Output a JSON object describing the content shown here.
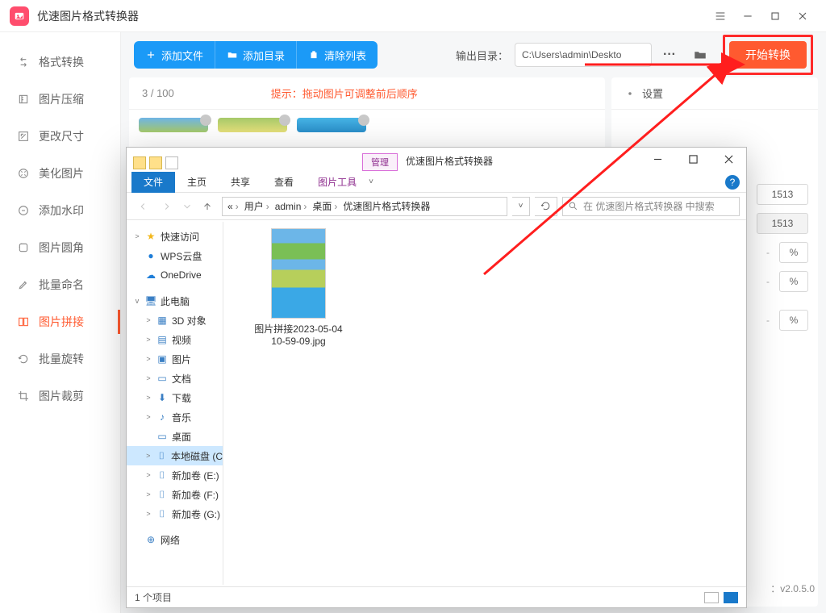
{
  "app": {
    "title": "优速图片格式转换器",
    "window_buttons": {
      "menu": "≡",
      "min": "—",
      "max": "⛶",
      "close": "✕"
    }
  },
  "sidebar": {
    "items": [
      {
        "label": "格式转换",
        "icon": "convert"
      },
      {
        "label": "图片压缩",
        "icon": "compress"
      },
      {
        "label": "更改尺寸",
        "icon": "resize"
      },
      {
        "label": "美化图片",
        "icon": "beautify"
      },
      {
        "label": "添加水印",
        "icon": "watermark"
      },
      {
        "label": "图片圆角",
        "icon": "corner"
      },
      {
        "label": "批量命名",
        "icon": "rename"
      },
      {
        "label": "图片拼接",
        "icon": "stitch",
        "active": true
      },
      {
        "label": "批量旋转",
        "icon": "rotate"
      },
      {
        "label": "图片裁剪",
        "icon": "crop"
      }
    ]
  },
  "toolbar": {
    "add_file": "添加文件",
    "add_dir": "添加目录",
    "clear": "清除列表",
    "out_label": "输出目录：",
    "out_path": "C:\\Users\\admin\\Deskto",
    "start": "开始转换"
  },
  "canvas": {
    "count": "3 / 100",
    "hint": "提示：拖动图片可调整前后顺序"
  },
  "rightpanel": {
    "settings_label": "设置",
    "values": {
      "w": "1513",
      "h": "1513"
    },
    "unit": "%"
  },
  "explorer": {
    "manage_tab": "管理",
    "window_title": "优速图片格式转换器",
    "ribbon": {
      "file": "文件",
      "home": "主页",
      "share": "共享",
      "view": "查看",
      "pic": "图片工具"
    },
    "breadcrumb": [
      "«",
      "用户",
      "admin",
      "桌面",
      "优速图片格式转换器"
    ],
    "search_placeholder": "在 优速图片格式转换器 中搜索",
    "tree": [
      {
        "label": "快速访问",
        "icon": "star",
        "chev": ">"
      },
      {
        "label": "WPS云盘",
        "icon": "wps",
        "chev": ""
      },
      {
        "label": "OneDrive",
        "icon": "onedrive",
        "chev": ""
      },
      {
        "label": "此电脑",
        "icon": "pc",
        "chev": "v"
      },
      {
        "label": "3D 对象",
        "icon": "3d",
        "chev": ">",
        "indent": 2
      },
      {
        "label": "视频",
        "icon": "video",
        "chev": ">",
        "indent": 2
      },
      {
        "label": "图片",
        "icon": "pic",
        "chev": ">",
        "indent": 2
      },
      {
        "label": "文档",
        "icon": "doc",
        "chev": ">",
        "indent": 2
      },
      {
        "label": "下载",
        "icon": "dl",
        "chev": ">",
        "indent": 2
      },
      {
        "label": "音乐",
        "icon": "music",
        "chev": ">",
        "indent": 2
      },
      {
        "label": "桌面",
        "icon": "desktop",
        "chev": "",
        "indent": 2
      },
      {
        "label": "本地磁盘 (C",
        "icon": "disk",
        "chev": ">",
        "indent": 2,
        "selected": true
      },
      {
        "label": "新加卷 (E:)",
        "icon": "disk",
        "chev": ">",
        "indent": 2
      },
      {
        "label": "新加卷 (F:)",
        "icon": "disk",
        "chev": ">",
        "indent": 2
      },
      {
        "label": "新加卷 (G:)",
        "icon": "disk",
        "chev": ">",
        "indent": 2
      },
      {
        "label": "网络",
        "icon": "net",
        "chev": ""
      }
    ],
    "file": {
      "name": "图片拼接2023-05-04 10-59-09.jpg"
    },
    "status": "1 个项目"
  },
  "footer": {
    "version": "v2.0.5.0",
    "version_prefix": "："
  }
}
